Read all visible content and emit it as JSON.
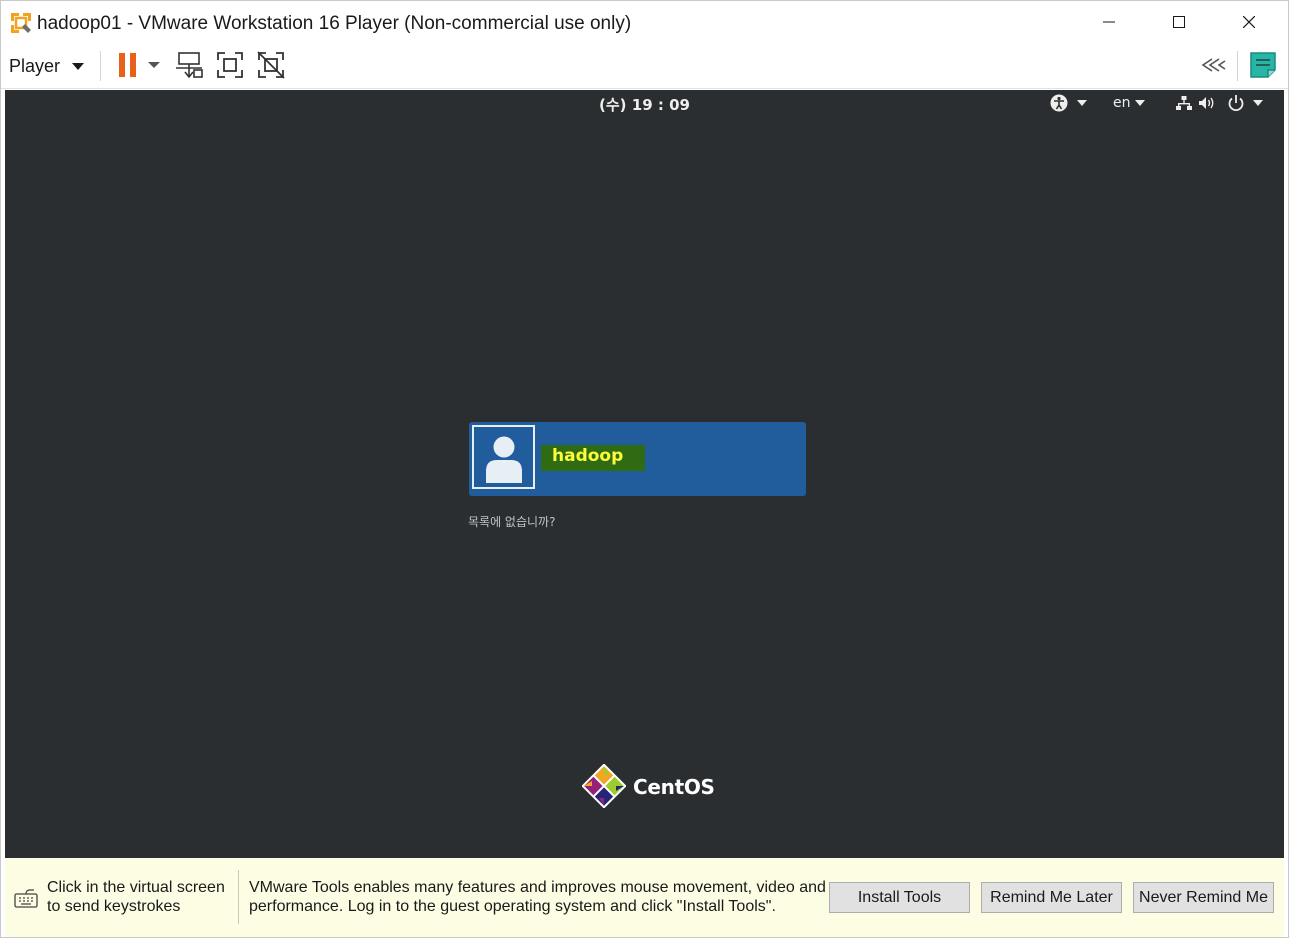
{
  "window": {
    "title": "hadoop01 - VMware Workstation 16 Player (Non-commercial use only)",
    "controls": {
      "minimize": "minimize-icon",
      "maximize": "maximize-icon",
      "close": "close-icon"
    }
  },
  "toolbar": {
    "player_label": "Player",
    "icons": [
      "pause-icon",
      "send-ctrl-alt-del-icon",
      "full-screen-icon",
      "unity-icon",
      "collapse-icon",
      "library-notes-icon"
    ]
  },
  "guest": {
    "clock": "(수) 19 : 09",
    "language": "en",
    "system_icons": [
      "accessibility-icon",
      "network-icon",
      "volume-icon",
      "power-icon"
    ],
    "login": {
      "user_name": "hadoop",
      "not_listed": "목록에 없습니까?"
    },
    "brand": "CentOS"
  },
  "hint_bar": {
    "click_hint": "Click in the virtual screen to send keystrokes",
    "tools_message": "VMware Tools enables many features and improves mouse movement, video and performance. Log in to the guest operating system and click \"Install Tools\".",
    "install_button": "Install Tools",
    "remind_later_button": "Remind Me Later",
    "never_remind_button": "Never Remind Me"
  },
  "colors": {
    "guest_background": "#2b2e31",
    "user_card": "#215d9c",
    "name_highlight": "#2f6b12",
    "name_text": "#fdfd3c",
    "pause_accent": "#e8611a",
    "notes_accent": "#27b5a5",
    "hint_bar_bg": "#fdfde4"
  }
}
